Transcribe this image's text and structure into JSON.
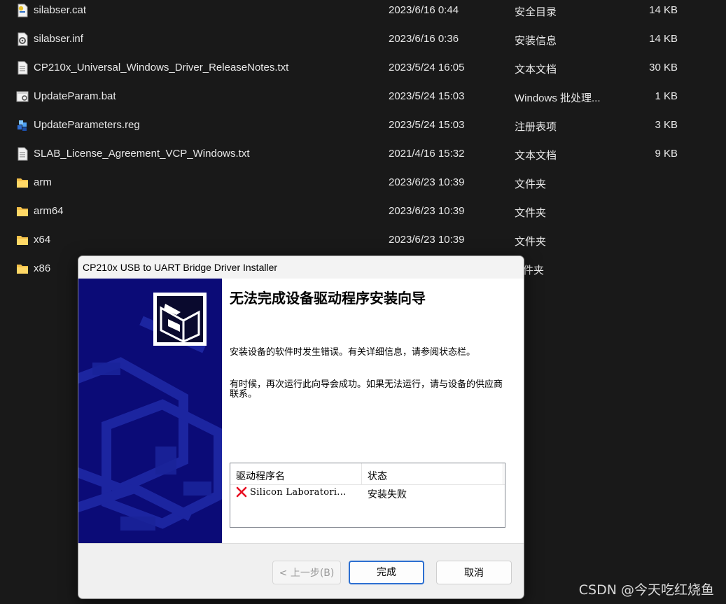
{
  "files": [
    {
      "icon": "catalog-file-icon",
      "name": "silabser.cat",
      "date": "2023/6/16 0:44",
      "type": "安全目录",
      "size": "14 KB"
    },
    {
      "icon": "setup-info-file-icon",
      "name": "silabser.inf",
      "date": "2023/6/16 0:36",
      "type": "安装信息",
      "size": "14 KB"
    },
    {
      "icon": "text-file-icon",
      "name": "CP210x_Universal_Windows_Driver_ReleaseNotes.txt",
      "date": "2023/5/24 16:05",
      "type": "文本文档",
      "size": "30 KB"
    },
    {
      "icon": "batch-file-icon",
      "name": "UpdateParam.bat",
      "date": "2023/5/24 15:03",
      "type": "Windows 批处理...",
      "size": "1 KB"
    },
    {
      "icon": "registry-file-icon",
      "name": "UpdateParameters.reg",
      "date": "2023/5/24 15:03",
      "type": "注册表项",
      "size": "3 KB"
    },
    {
      "icon": "text-file-icon",
      "name": "SLAB_License_Agreement_VCP_Windows.txt",
      "date": "2021/4/16 15:32",
      "type": "文本文档",
      "size": "9 KB"
    },
    {
      "icon": "folder-icon",
      "name": "arm",
      "date": "2023/6/23 10:39",
      "type": "文件夹",
      "size": ""
    },
    {
      "icon": "folder-icon",
      "name": "arm64",
      "date": "2023/6/23 10:39",
      "type": "文件夹",
      "size": ""
    },
    {
      "icon": "folder-icon",
      "name": "x64",
      "date": "2023/6/23 10:39",
      "type": "文件夹",
      "size": ""
    },
    {
      "icon": "folder-icon",
      "name": "x86",
      "date": "",
      "type": "件夹",
      "size": ""
    }
  ],
  "dialog": {
    "title": "CP210x USB to UART Bridge Driver Installer",
    "heading": "无法完成设备驱动程序安装向导",
    "message1": "安装设备的软件时发生错误。有关详细信息，请参阅状态栏。",
    "message2": "有时候，再次运行此向导会成功。如果无法运行，请与设备的供应商联系。",
    "table": {
      "columns": [
        "驱动程序名",
        "状态"
      ],
      "rows": [
        {
          "driver": "Silicon Laboratori...",
          "status": "安装失败",
          "icon": "error-x-icon"
        }
      ]
    },
    "buttons": {
      "back": "< 上一步(B)",
      "finish": "完成",
      "cancel": "取消"
    }
  },
  "watermark": "CSDN @今天吃红烧鱼",
  "colors": {
    "background": "#191919",
    "sidebar": "#0b0b77",
    "folder": "#f4c04a",
    "error": "#e81123",
    "primary_border": "#2c6fd1"
  }
}
